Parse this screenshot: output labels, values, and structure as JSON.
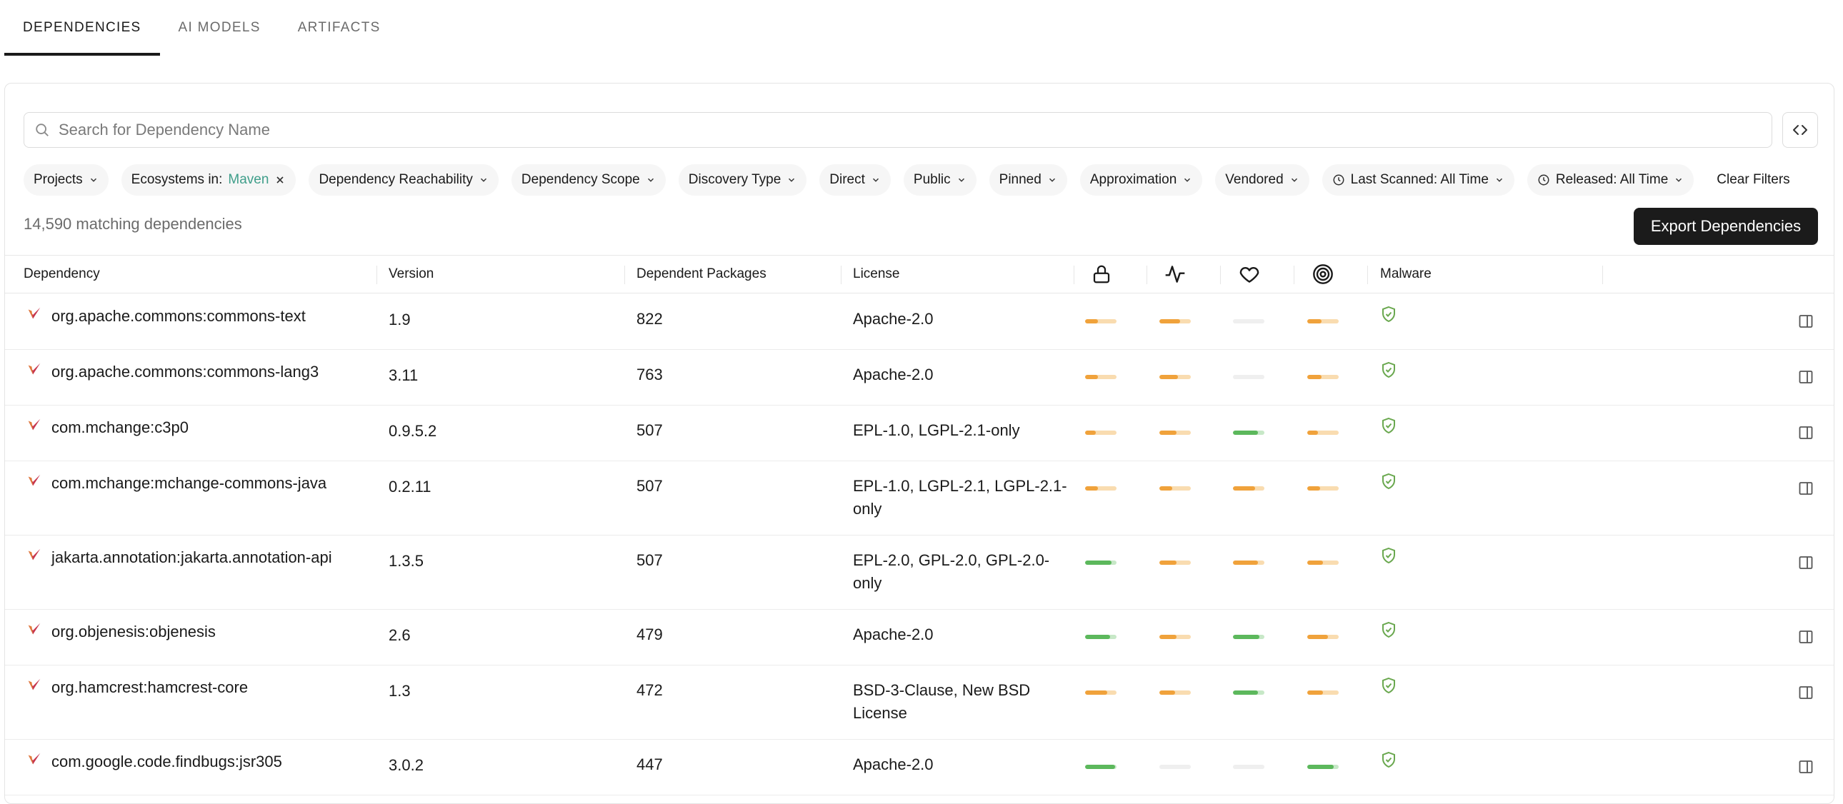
{
  "tabs": [
    {
      "label": "DEPENDENCIES",
      "active": true
    },
    {
      "label": "AI MODELS",
      "active": false
    },
    {
      "label": "ARTIFACTS",
      "active": false
    }
  ],
  "search": {
    "placeholder": "Search for Dependency Name",
    "value": ""
  },
  "filters": {
    "projects": "Projects",
    "ecosystems_prefix": "Ecosystems in:",
    "ecosystems_value": "Maven",
    "reachability": "Dependency Reachability",
    "scope": "Dependency Scope",
    "discovery": "Discovery Type",
    "direct": "Direct",
    "public": "Public",
    "pinned": "Pinned",
    "approximation": "Approximation",
    "vendored": "Vendored",
    "last_scanned": "Last Scanned: All Time",
    "released": "Released: All Time",
    "clear": "Clear Filters"
  },
  "summary": {
    "count_text": "14,590 matching dependencies",
    "export_label": "Export Dependencies"
  },
  "table": {
    "headers": {
      "dependency": "Dependency",
      "version": "Version",
      "dependents": "Dependent Packages",
      "license": "License",
      "malware": "Malware"
    },
    "score_icons": [
      "lock-icon",
      "activity-icon",
      "heart-icon",
      "target-icon"
    ],
    "colors": {
      "orange": "#f0a23b",
      "orange_light": "#f9dcb0",
      "green": "#5cb85c",
      "green_light": "#c7e8c7",
      "gray": "#efefef",
      "shield": "#6aa84f",
      "maven": "#c7374f"
    },
    "rows": [
      {
        "name": "org.apache.commons:commons-text",
        "version": "1.9",
        "dependents": "822",
        "license": [
          "Apache-2.0"
        ],
        "scores": [
          {
            "c": "orange",
            "v": 0.4
          },
          {
            "c": "orange",
            "v": 0.65
          },
          {
            "c": "gray",
            "v": 0
          },
          {
            "c": "orange",
            "v": 0.45
          }
        ]
      },
      {
        "name": "org.apache.commons:commons-lang3",
        "version": "3.11",
        "dependents": "763",
        "license": [
          "Apache-2.0"
        ],
        "scores": [
          {
            "c": "orange",
            "v": 0.4
          },
          {
            "c": "orange",
            "v": 0.6
          },
          {
            "c": "gray",
            "v": 0
          },
          {
            "c": "orange",
            "v": 0.45
          }
        ]
      },
      {
        "name": "com.mchange:c3p0",
        "version": "0.9.5.2",
        "dependents": "507",
        "license": [
          "EPL-1.0, LGPL-2.1-only"
        ],
        "scores": [
          {
            "c": "orange",
            "v": 0.35
          },
          {
            "c": "orange",
            "v": 0.55
          },
          {
            "c": "green",
            "v": 0.8
          },
          {
            "c": "orange",
            "v": 0.35
          }
        ]
      },
      {
        "name": "com.mchange:mchange-commons-java",
        "version": "0.2.11",
        "dependents": "507",
        "license": [
          "EPL-1.0, LGPL-2.1, LGPL-2.1-",
          "only"
        ],
        "scores": [
          {
            "c": "orange",
            "v": 0.4
          },
          {
            "c": "orange",
            "v": 0.4
          },
          {
            "c": "orange",
            "v": 0.7
          },
          {
            "c": "orange",
            "v": 0.4
          }
        ]
      },
      {
        "name": "jakarta.annotation:jakarta.annotation-api",
        "version": "1.3.5",
        "dependents": "507",
        "license": [
          "EPL-2.0, GPL-2.0, GPL-2.0-",
          "only"
        ],
        "scores": [
          {
            "c": "green",
            "v": 0.85
          },
          {
            "c": "orange",
            "v": 0.55
          },
          {
            "c": "orange",
            "v": 0.8
          },
          {
            "c": "orange",
            "v": 0.5
          }
        ]
      },
      {
        "name": "org.objenesis:objenesis",
        "version": "2.6",
        "dependents": "479",
        "license": [
          "Apache-2.0"
        ],
        "scores": [
          {
            "c": "green",
            "v": 0.8
          },
          {
            "c": "orange",
            "v": 0.55
          },
          {
            "c": "green",
            "v": 0.85
          },
          {
            "c": "orange",
            "v": 0.65
          }
        ]
      },
      {
        "name": "org.hamcrest:hamcrest-core",
        "version": "1.3",
        "dependents": "472",
        "license": [
          "BSD-3-Clause, New BSD",
          "License"
        ],
        "scores": [
          {
            "c": "orange",
            "v": 0.7
          },
          {
            "c": "orange",
            "v": 0.5
          },
          {
            "c": "green",
            "v": 0.8
          },
          {
            "c": "orange",
            "v": 0.5
          }
        ]
      },
      {
        "name": "com.google.code.findbugs:jsr305",
        "version": "3.0.2",
        "dependents": "447",
        "license": [
          "Apache-2.0"
        ],
        "scores": [
          {
            "c": "green",
            "v": 0.95
          },
          {
            "c": "gray",
            "v": 0
          },
          {
            "c": "gray",
            "v": 0
          },
          {
            "c": "green",
            "v": 0.85
          }
        ]
      }
    ]
  }
}
